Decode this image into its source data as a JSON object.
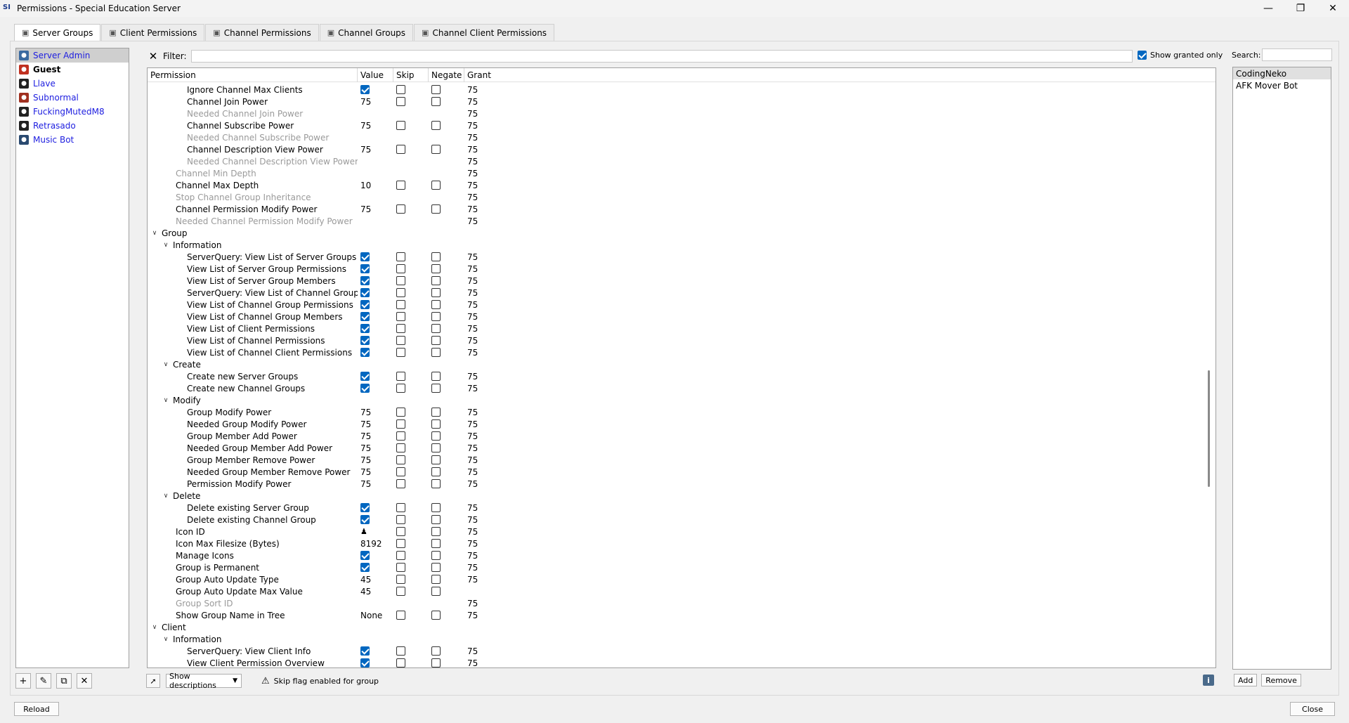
{
  "window": {
    "title": "Permissions - Special Education Server",
    "app_icon": "SI"
  },
  "tabs": [
    {
      "label": "Server Groups",
      "icon": "server-groups-icon",
      "active": true
    },
    {
      "label": "Client Permissions",
      "icon": "client-permissions-icon",
      "active": false
    },
    {
      "label": "Channel Permissions",
      "icon": "channel-permissions-icon",
      "active": false
    },
    {
      "label": "Channel Groups",
      "icon": "channel-groups-icon",
      "active": false
    },
    {
      "label": "Channel Client Permissions",
      "icon": "channel-client-permissions-icon",
      "active": false
    }
  ],
  "groups": [
    {
      "name": "Server Admin",
      "icon_color": "#3a6aa0",
      "selected": true,
      "bold": false
    },
    {
      "name": "Guest",
      "icon_color": "#c03020",
      "selected": false,
      "bold": true
    },
    {
      "name": "Llave",
      "icon_color": "#222222",
      "selected": false,
      "bold": false
    },
    {
      "name": "Subnormal",
      "icon_color": "#a03020",
      "selected": false,
      "bold": false
    },
    {
      "name": "FuckingMutedM8",
      "icon_color": "#222222",
      "selected": false,
      "bold": false
    },
    {
      "name": "Retrasado",
      "icon_color": "#222222",
      "selected": false,
      "bold": false
    },
    {
      "name": "Music Bot",
      "icon_color": "#2a4a70",
      "selected": false,
      "bold": false
    }
  ],
  "filter": {
    "label": "Filter:",
    "value": "",
    "show_granted_only_label": "Show granted only",
    "show_granted_only": true
  },
  "columns": {
    "permission": "Permission",
    "value": "Value",
    "skip": "Skip",
    "negate": "Negate",
    "grant": "Grant"
  },
  "rows": [
    {
      "level": 3,
      "name": "Ignore Channel Max Clients",
      "value_type": "check",
      "value": "",
      "skip": true,
      "negate": true,
      "grant": "75"
    },
    {
      "level": 3,
      "name": "Channel Join Power",
      "value_type": "text",
      "value": "75",
      "skip": true,
      "negate": true,
      "grant": "75"
    },
    {
      "level": 3,
      "name": "Needed Channel Join Power",
      "dim": true,
      "value_type": "none",
      "value": "",
      "skip": false,
      "negate": false,
      "grant": "75"
    },
    {
      "level": 3,
      "name": "Channel Subscribe Power",
      "value_type": "text",
      "value": "75",
      "skip": true,
      "negate": true,
      "grant": "75"
    },
    {
      "level": 3,
      "name": "Needed Channel Subscribe Power",
      "dim": true,
      "value_type": "none",
      "value": "",
      "skip": false,
      "negate": false,
      "grant": "75"
    },
    {
      "level": 3,
      "name": "Channel Description View Power",
      "value_type": "text",
      "value": "75",
      "skip": true,
      "negate": true,
      "grant": "75"
    },
    {
      "level": 3,
      "name": "Needed Channel Description View Power",
      "dim": true,
      "value_type": "none",
      "value": "",
      "skip": false,
      "negate": false,
      "grant": "75"
    },
    {
      "level": 2,
      "name": "Channel Min Depth",
      "dim": true,
      "value_type": "none",
      "value": "",
      "skip": false,
      "negate": false,
      "grant": "75"
    },
    {
      "level": 2,
      "name": "Channel Max Depth",
      "value_type": "text",
      "value": "10",
      "skip": true,
      "negate": true,
      "grant": "75"
    },
    {
      "level": 2,
      "name": "Stop Channel Group Inheritance",
      "dim": true,
      "value_type": "none",
      "value": "",
      "skip": false,
      "negate": false,
      "grant": "75"
    },
    {
      "level": 2,
      "name": "Channel Permission Modify Power",
      "value_type": "text",
      "value": "75",
      "skip": true,
      "negate": true,
      "grant": "75"
    },
    {
      "level": 2,
      "name": "Needed Channel Permission Modify Power",
      "dim": true,
      "value_type": "none",
      "value": "",
      "skip": false,
      "negate": false,
      "grant": "75"
    },
    {
      "level": 0,
      "name": "Group",
      "category": true
    },
    {
      "level": 1,
      "name": "Information",
      "category": true
    },
    {
      "level": 3,
      "name": "ServerQuery: View List of Server Groups",
      "value_type": "check",
      "value": "",
      "skip": true,
      "negate": true,
      "grant": "75"
    },
    {
      "level": 3,
      "name": "View List of Server Group Permissions",
      "value_type": "check",
      "value": "",
      "skip": true,
      "negate": true,
      "grant": "75"
    },
    {
      "level": 3,
      "name": "View List of Server Group Members",
      "value_type": "check",
      "value": "",
      "skip": true,
      "negate": true,
      "grant": "75"
    },
    {
      "level": 3,
      "name": "ServerQuery: View List of Channel Groups",
      "value_type": "check",
      "value": "",
      "skip": true,
      "negate": true,
      "grant": "75"
    },
    {
      "level": 3,
      "name": "View List of Channel Group Permissions",
      "value_type": "check",
      "value": "",
      "skip": true,
      "negate": true,
      "grant": "75"
    },
    {
      "level": 3,
      "name": "View List of Channel Group Members",
      "value_type": "check",
      "value": "",
      "skip": true,
      "negate": true,
      "grant": "75"
    },
    {
      "level": 3,
      "name": "View List of Client Permissions",
      "value_type": "check",
      "value": "",
      "skip": true,
      "negate": true,
      "grant": "75"
    },
    {
      "level": 3,
      "name": "View List of Channel Permissions",
      "value_type": "check",
      "value": "",
      "skip": true,
      "negate": true,
      "grant": "75"
    },
    {
      "level": 3,
      "name": "View List of Channel Client Permissions",
      "value_type": "check",
      "value": "",
      "skip": true,
      "negate": true,
      "grant": "75"
    },
    {
      "level": 1,
      "name": "Create",
      "category": true
    },
    {
      "level": 3,
      "name": "Create new Server Groups",
      "value_type": "check",
      "value": "",
      "skip": true,
      "negate": true,
      "grant": "75"
    },
    {
      "level": 3,
      "name": "Create new Channel Groups",
      "value_type": "check",
      "value": "",
      "skip": true,
      "negate": true,
      "grant": "75"
    },
    {
      "level": 1,
      "name": "Modify",
      "category": true
    },
    {
      "level": 3,
      "name": "Group Modify Power",
      "value_type": "text",
      "value": "75",
      "skip": true,
      "negate": true,
      "grant": "75"
    },
    {
      "level": 3,
      "name": "Needed Group Modify Power",
      "value_type": "text",
      "value": "75",
      "skip": true,
      "negate": true,
      "grant": "75"
    },
    {
      "level": 3,
      "name": "Group Member Add Power",
      "value_type": "text",
      "value": "75",
      "skip": true,
      "negate": true,
      "grant": "75"
    },
    {
      "level": 3,
      "name": "Needed Group Member Add Power",
      "value_type": "text",
      "value": "75",
      "skip": true,
      "negate": true,
      "grant": "75"
    },
    {
      "level": 3,
      "name": "Group Member Remove Power",
      "value_type": "text",
      "value": "75",
      "skip": true,
      "negate": true,
      "grant": "75"
    },
    {
      "level": 3,
      "name": "Needed Group Member Remove Power",
      "value_type": "text",
      "value": "75",
      "skip": true,
      "negate": true,
      "grant": "75"
    },
    {
      "level": 3,
      "name": "Permission Modify Power",
      "value_type": "text",
      "value": "75",
      "skip": true,
      "negate": true,
      "grant": "75"
    },
    {
      "level": 1,
      "name": "Delete",
      "category": true
    },
    {
      "level": 3,
      "name": "Delete existing Server Group",
      "value_type": "check",
      "value": "",
      "skip": true,
      "negate": true,
      "grant": "75"
    },
    {
      "level": 3,
      "name": "Delete existing Channel Group",
      "value_type": "check",
      "value": "",
      "skip": true,
      "negate": true,
      "grant": "75"
    },
    {
      "level": 2,
      "name": "Icon ID",
      "value_type": "icon",
      "value": "",
      "skip": true,
      "negate": true,
      "grant": "75"
    },
    {
      "level": 2,
      "name": "Icon Max Filesize (Bytes)",
      "value_type": "text",
      "value": "8192",
      "skip": true,
      "negate": true,
      "grant": "75"
    },
    {
      "level": 2,
      "name": "Manage Icons",
      "value_type": "check",
      "value": "",
      "skip": true,
      "negate": true,
      "grant": "75"
    },
    {
      "level": 2,
      "name": "Group is Permanent",
      "value_type": "check",
      "value": "",
      "skip": true,
      "negate": true,
      "grant": "75"
    },
    {
      "level": 2,
      "name": "Group Auto Update Type",
      "value_type": "text",
      "value": "45",
      "skip": true,
      "negate": true,
      "grant": "75"
    },
    {
      "level": 2,
      "name": "Group Auto Update Max Value",
      "value_type": "text",
      "value": "45",
      "skip": true,
      "negate": true,
      "grant": ""
    },
    {
      "level": 2,
      "name": "Group Sort ID",
      "dim": true,
      "value_type": "none",
      "value": "",
      "skip": false,
      "negate": false,
      "grant": "75"
    },
    {
      "level": 2,
      "name": "Show Group Name in Tree",
      "value_type": "text",
      "value": "None",
      "skip": true,
      "negate": true,
      "grant": "75"
    },
    {
      "level": 0,
      "name": "Client",
      "category": true
    },
    {
      "level": 1,
      "name": "Information",
      "category": true
    },
    {
      "level": 3,
      "name": "ServerQuery: View Client Info",
      "value_type": "check",
      "value": "",
      "skip": true,
      "negate": true,
      "grant": "75"
    },
    {
      "level": 3,
      "name": "View Client Permission Overview",
      "value_type": "check",
      "value": "",
      "skip": true,
      "negate": true,
      "grant": "75"
    }
  ],
  "bottom": {
    "descriptions_select": "Show descriptions",
    "warning_text": "Skip flag enabled for group"
  },
  "search": {
    "label": "Search:",
    "value": ""
  },
  "clients": [
    {
      "name": "CodingNeko",
      "selected": true
    },
    {
      "name": "AFK Mover Bot",
      "selected": false
    }
  ],
  "buttons": {
    "add": "Add",
    "remove": "Remove",
    "reload": "Reload",
    "close": "Close"
  },
  "colors": {
    "accent": "#0067c0",
    "group_link": "#2020e0",
    "dim_text": "#9a9a9a"
  }
}
